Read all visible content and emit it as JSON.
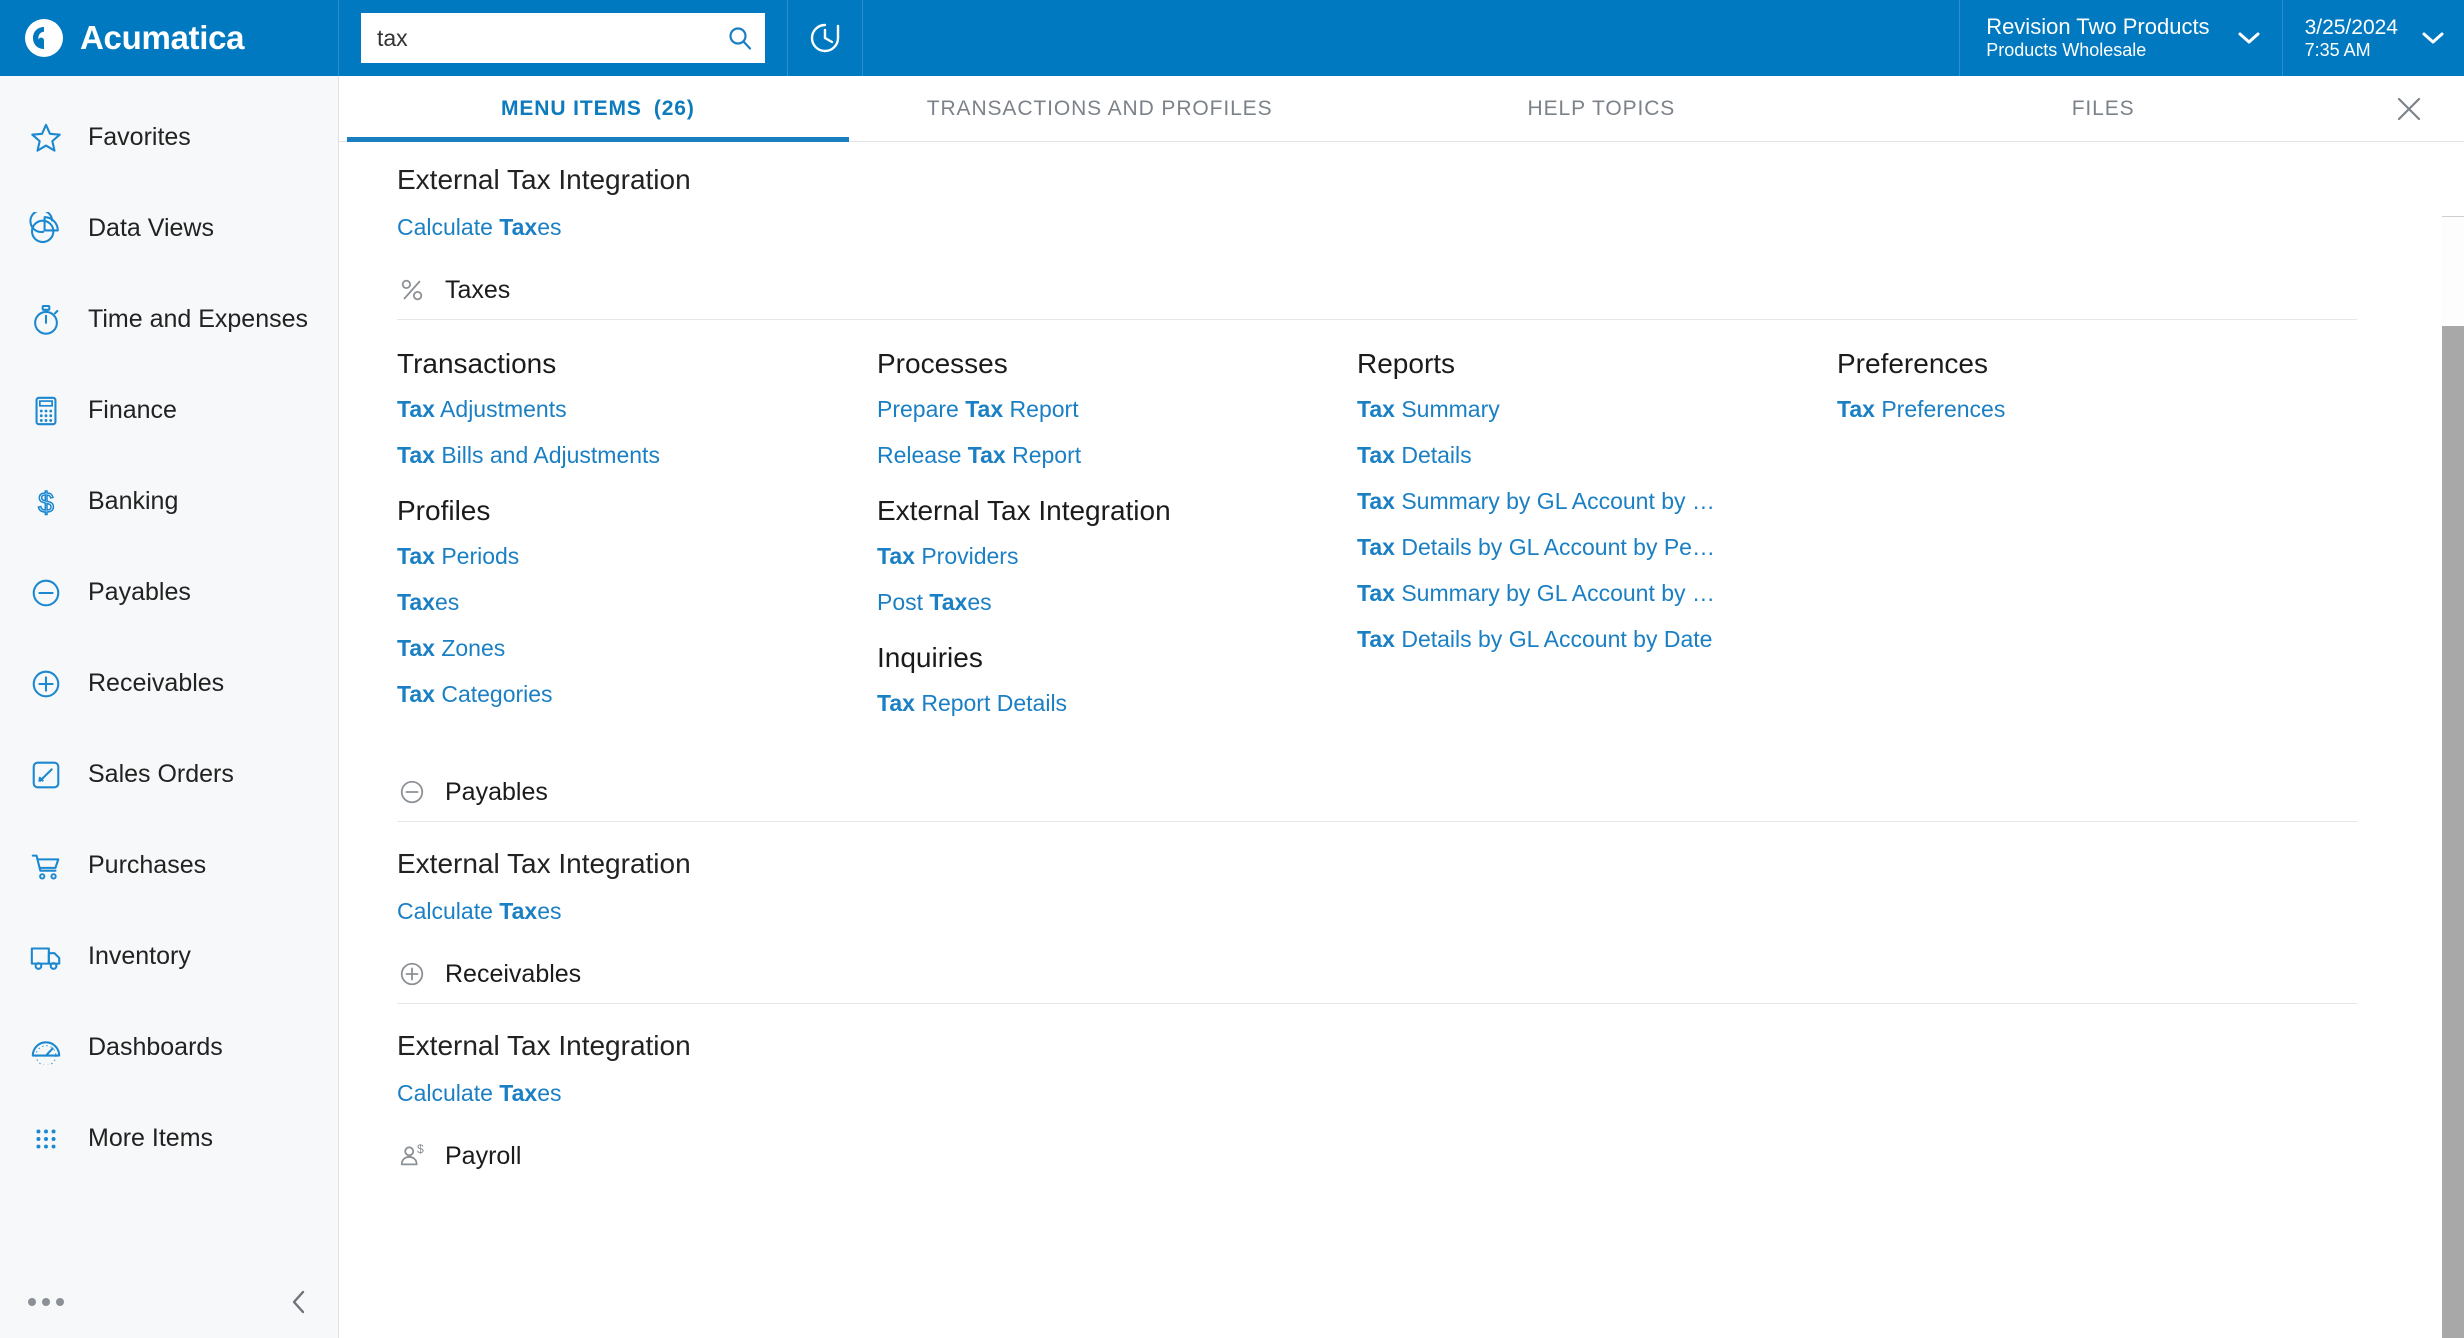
{
  "header": {
    "brand": "Acumatica",
    "brand_logo_icon": "acumatica-logo-icon",
    "search": {
      "value": "tax",
      "placeholder": "Search",
      "icon": "search-icon"
    },
    "history_icon": "clock-history-icon",
    "company": {
      "name": "Revision Two Products",
      "branch": "Products Wholesale",
      "chevron_icon": "chevron-down-icon"
    },
    "datetime": {
      "date": "3/25/2024",
      "time": "7:35 AM",
      "chevron_icon": "chevron-down-icon"
    },
    "accent_color": "#0079c1"
  },
  "sidebar": {
    "items": [
      {
        "label": "Favorites",
        "icon": "star-icon"
      },
      {
        "label": "Data Views",
        "icon": "pie-chart-icon"
      },
      {
        "label": "Time and Expenses",
        "icon": "stopwatch-icon"
      },
      {
        "label": "Finance",
        "icon": "calculator-icon"
      },
      {
        "label": "Banking",
        "icon": "dollar-sign-icon"
      },
      {
        "label": "Payables",
        "icon": "minus-circle-icon"
      },
      {
        "label": "Receivables",
        "icon": "plus-circle-icon"
      },
      {
        "label": "Sales Orders",
        "icon": "pencil-square-icon"
      },
      {
        "label": "Purchases",
        "icon": "shopping-cart-icon"
      },
      {
        "label": "Inventory",
        "icon": "truck-icon"
      },
      {
        "label": "Dashboards",
        "icon": "gauge-icon"
      },
      {
        "label": "More Items",
        "icon": "dot-grid-icon"
      }
    ],
    "footer": {
      "more_icon": "ellipsis-icon",
      "collapse_icon": "chevron-left-icon"
    },
    "icon_color": "#1b88d0"
  },
  "tabs": [
    {
      "label": "MENU ITEMS",
      "count": "(26)",
      "active": true
    },
    {
      "label": "TRANSACTIONS AND PROFILES",
      "count": "",
      "active": false
    },
    {
      "label": "HELP TOPICS",
      "count": "",
      "active": false
    },
    {
      "label": "FILES",
      "count": "",
      "active": false
    }
  ],
  "close_icon": "close-icon",
  "results": {
    "top_block": {
      "title": "External Tax Integration",
      "links": [
        {
          "pre": "Calculate ",
          "match": "Tax",
          "post": "es"
        }
      ]
    },
    "sections": [
      {
        "name": "Taxes",
        "icon": "percent-icon",
        "columns": [
          {
            "groups": [
              {
                "head": "Transactions",
                "links": [
                  {
                    "pre": "",
                    "match": "Tax",
                    "post": " Adjustments"
                  },
                  {
                    "pre": "",
                    "match": "Tax",
                    "post": " Bills and Adjustments"
                  }
                ]
              },
              {
                "head": "Profiles",
                "links": [
                  {
                    "pre": "",
                    "match": "Tax",
                    "post": " Periods"
                  },
                  {
                    "pre": "",
                    "match": "Tax",
                    "post": "es"
                  },
                  {
                    "pre": "",
                    "match": "Tax",
                    "post": " Zones"
                  },
                  {
                    "pre": "",
                    "match": "Tax",
                    "post": " Categories"
                  }
                ]
              }
            ]
          },
          {
            "groups": [
              {
                "head": "Processes",
                "links": [
                  {
                    "pre": "Prepare ",
                    "match": "Tax",
                    "post": " Report"
                  },
                  {
                    "pre": "Release ",
                    "match": "Tax",
                    "post": " Report"
                  }
                ]
              },
              {
                "head": "External Tax Integration",
                "links": [
                  {
                    "pre": "",
                    "match": "Tax",
                    "post": " Providers"
                  },
                  {
                    "pre": "Post ",
                    "match": "Tax",
                    "post": "es"
                  }
                ]
              },
              {
                "head": "Inquiries",
                "links": [
                  {
                    "pre": "",
                    "match": "Tax",
                    "post": " Report Details"
                  }
                ]
              }
            ]
          },
          {
            "groups": [
              {
                "head": "Reports",
                "links": [
                  {
                    "pre": "",
                    "match": "Tax",
                    "post": " Summary"
                  },
                  {
                    "pre": "",
                    "match": "Tax",
                    "post": " Details"
                  },
                  {
                    "pre": "",
                    "match": "Tax",
                    "post": " Summary by GL Account by …"
                  },
                  {
                    "pre": "",
                    "match": "Tax",
                    "post": " Details by GL Account by Pe…"
                  },
                  {
                    "pre": "",
                    "match": "Tax",
                    "post": " Summary by GL Account by …"
                  },
                  {
                    "pre": "",
                    "match": "Tax",
                    "post": " Details by GL Account by Date"
                  }
                ]
              }
            ]
          },
          {
            "groups": [
              {
                "head": "Preferences",
                "links": [
                  {
                    "pre": "",
                    "match": "Tax",
                    "post": " Preferences"
                  }
                ]
              }
            ]
          }
        ]
      },
      {
        "name": "Payables",
        "icon": "minus-circle-icon",
        "block": {
          "title": "External Tax Integration",
          "links": [
            {
              "pre": "Calculate ",
              "match": "Tax",
              "post": "es"
            }
          ]
        }
      },
      {
        "name": "Receivables",
        "icon": "plus-circle-icon",
        "block": {
          "title": "External Tax Integration",
          "links": [
            {
              "pre": "Calculate ",
              "match": "Tax",
              "post": "es"
            }
          ]
        }
      },
      {
        "name": "Payroll",
        "icon": "person-dollar-icon",
        "block": null
      }
    ],
    "link_color": "#1b7fc4"
  }
}
